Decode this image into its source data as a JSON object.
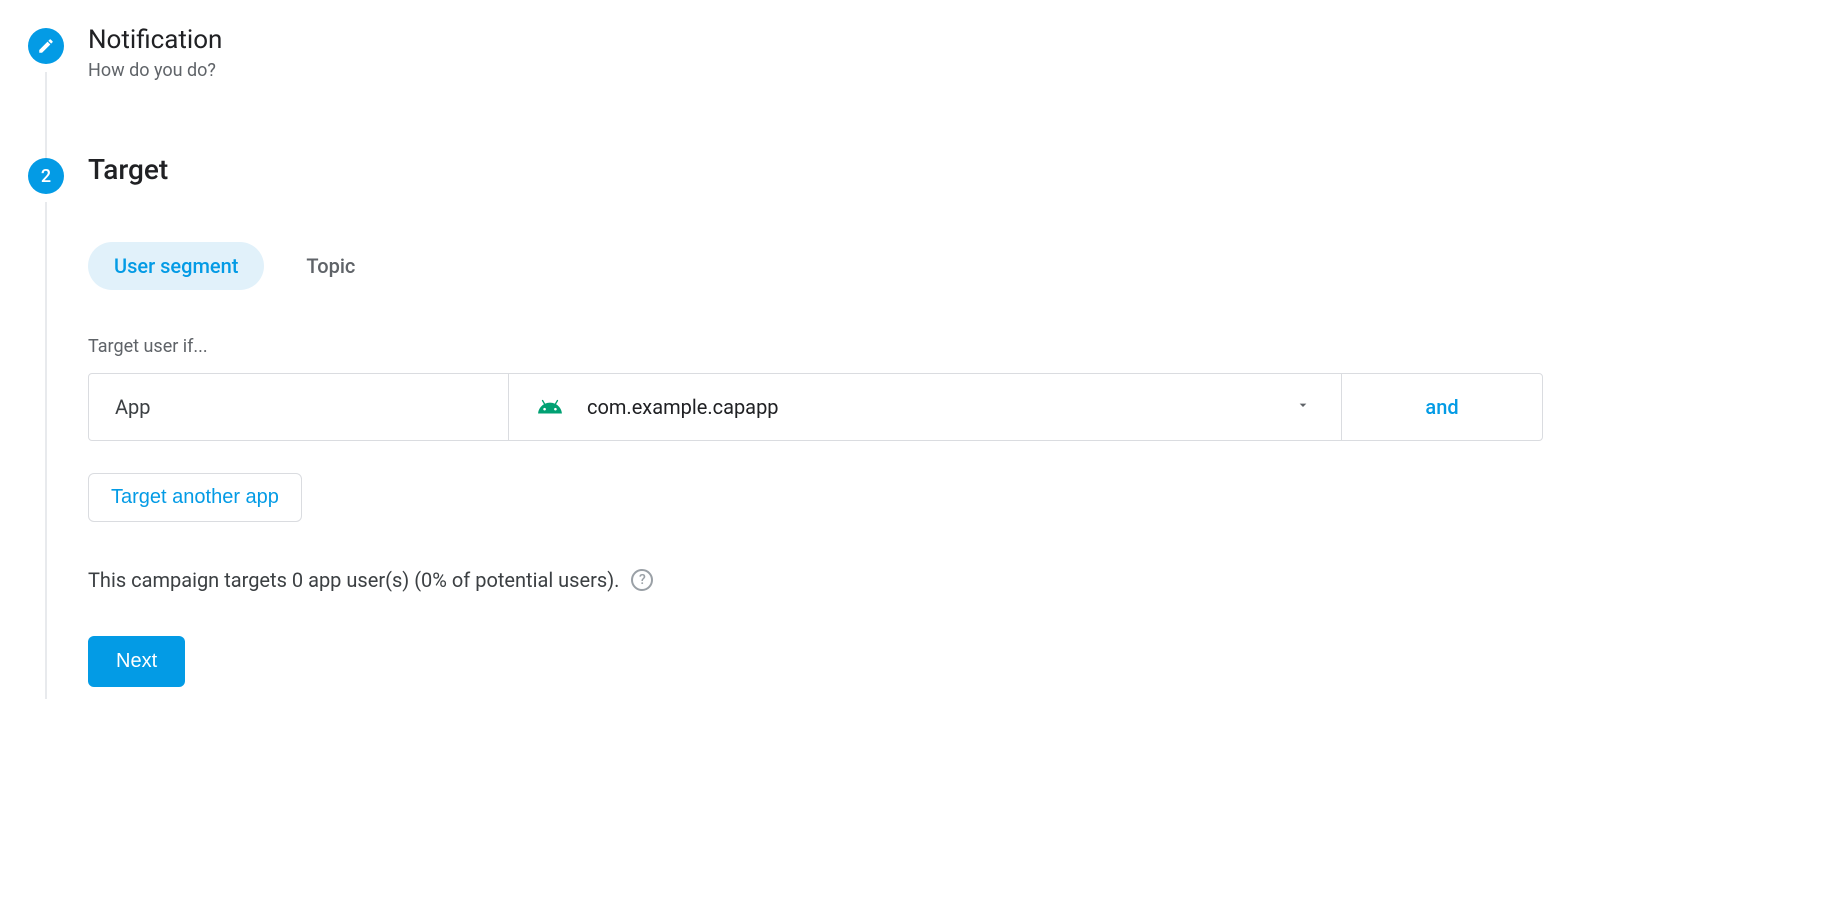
{
  "steps": {
    "notification": {
      "title": "Notification",
      "subtitle": "How do you do?"
    },
    "target": {
      "number": "2",
      "title": "Target"
    }
  },
  "tabs": {
    "user_segment": "User segment",
    "topic": "Topic"
  },
  "target": {
    "condition_label": "Target user if...",
    "filter_label": "App",
    "app_package": "com.example.capapp",
    "and_label": "and"
  },
  "buttons": {
    "target_another_app": "Target another app",
    "next": "Next"
  },
  "campaign_note": "This campaign targets 0 app user(s) (0% of potential users)."
}
